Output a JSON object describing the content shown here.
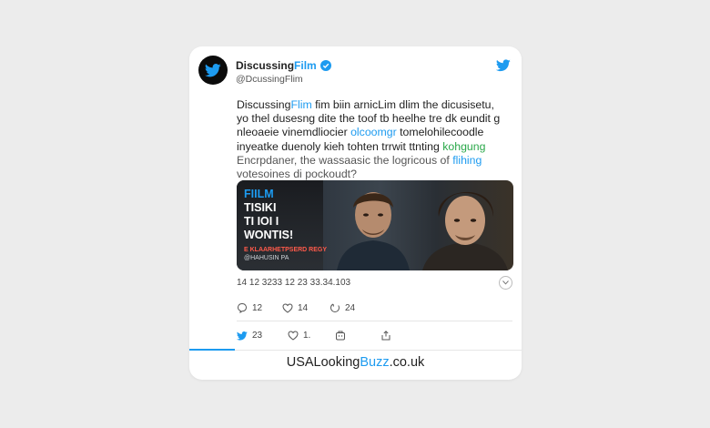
{
  "tweet": {
    "author_name_prefix": "Discussing",
    "author_name_suffix": "Film",
    "handle": "@DcussingFlim",
    "text_lines": [
      {
        "a": "Discussing",
        "b": "Flim",
        "c": " fim biin arnicLim dlim the dicusisetu,",
        "d": "",
        "e": ""
      },
      {
        "a": "yo thel dusesng dite the toof tb heelhe tre dk eundit g",
        "b": "",
        "c": "",
        "d": "",
        "e": ""
      },
      {
        "a": "nleoaeie vinemdliocier ",
        "b": "olcoomgr",
        "c": " tomelohilecoodle",
        "d": "",
        "e": ""
      },
      {
        "a": "inyeatke duenoly kieh tohten trrwit ttnting ",
        "b": "",
        "c": "",
        "d": "kohgung",
        "e": ""
      },
      {
        "a": "Encrpdaner, the wassaasic the logricous of ",
        "b": "flihing",
        "c": "",
        "d": "",
        "e": ""
      },
      {
        "a": "votesoines di pockoudt?",
        "b": "",
        "c": "",
        "d": "",
        "e": ""
      }
    ],
    "media": {
      "overlay_line1": "FIILM",
      "overlay_line2": "TISIKI",
      "overlay_line3": "TI IOI I",
      "overlay_line4": "WONTIS!",
      "overlay_sub_red": "E KLAARHETPSERD REGY",
      "overlay_sub_grey": "@HAHUSIN PA"
    },
    "stats": "14 12 3233 12    23 33.34.103",
    "actions_row1": [
      {
        "icon": "comment-icon",
        "count": "12"
      },
      {
        "icon": "heart-icon",
        "count": "14"
      },
      {
        "icon": "reply-icon",
        "count": "24"
      }
    ],
    "actions_row2": [
      {
        "icon": "twitter-bird-icon",
        "count": "23"
      },
      {
        "icon": "heart-icon",
        "count": "1."
      },
      {
        "icon": "bookmark-icon",
        "count": ""
      },
      {
        "icon": "share-icon",
        "count": ""
      }
    ]
  },
  "footer": {
    "site_prefix": "USALooking",
    "site_accent": "Buzz",
    "site_suffix": ".co.uk"
  },
  "colors": {
    "accent": "#1d9bf0",
    "background": "#ececec",
    "card": "#ffffff"
  }
}
